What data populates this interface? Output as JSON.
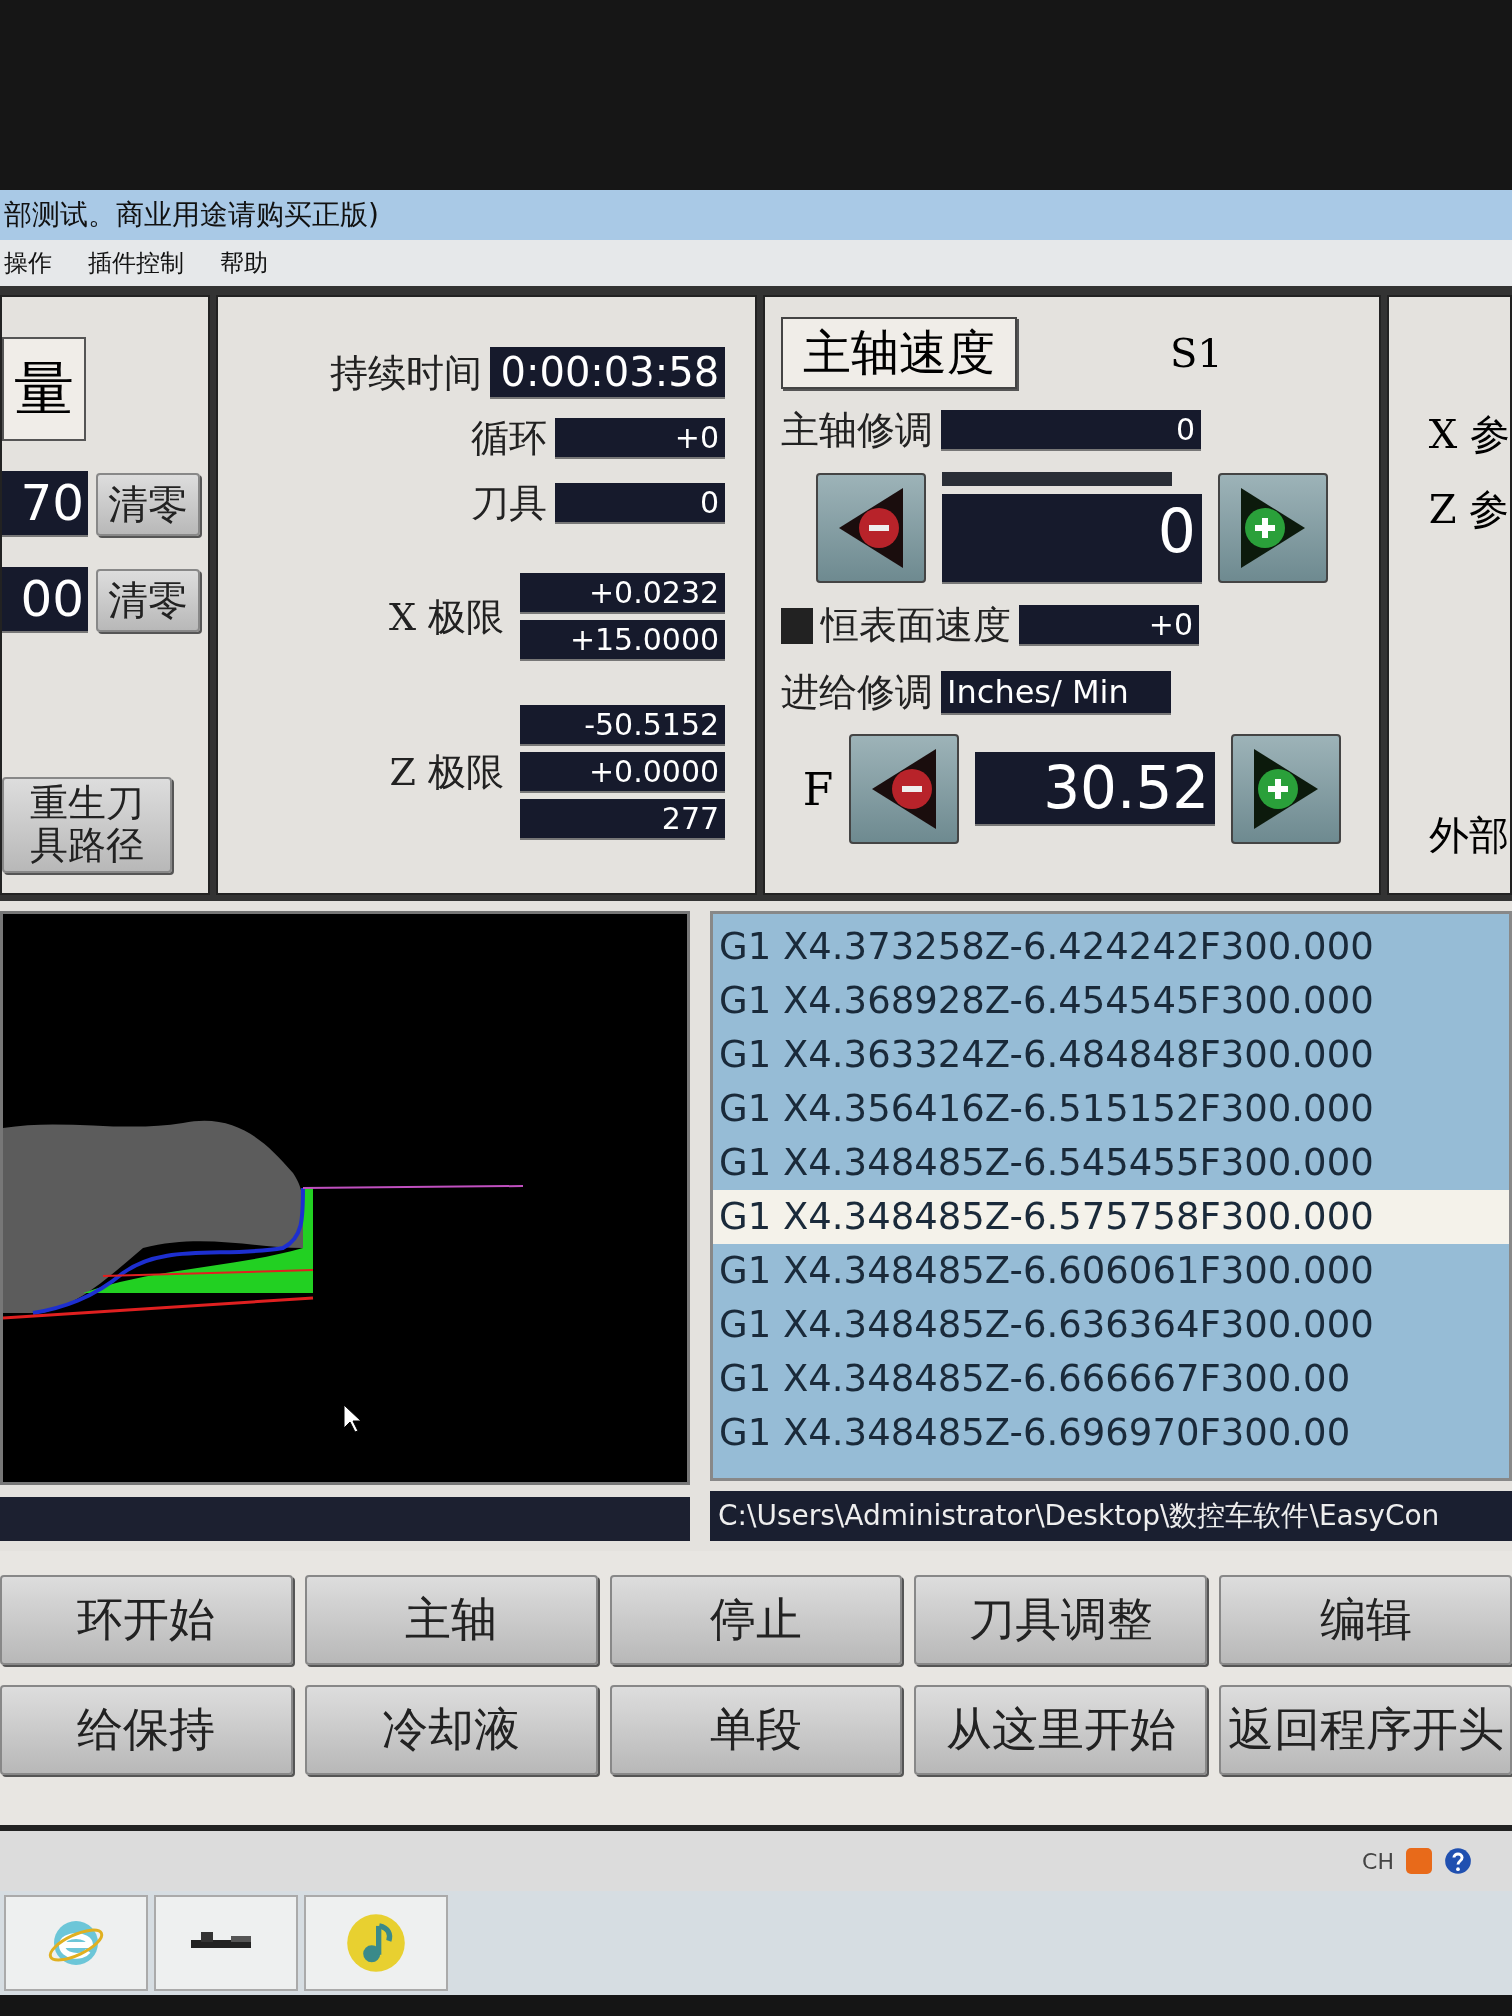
{
  "window": {
    "title": "部测试。商业用途请购买正版)"
  },
  "menu": [
    "操作",
    "插件控制",
    "帮助"
  ],
  "position_panel": {
    "heading": "量",
    "rows": [
      {
        "value": "70",
        "button": "清零"
      },
      {
        "value": "00",
        "button": "清零"
      }
    ],
    "regen_button": "重生刀具路径"
  },
  "status_panel": {
    "fields": [
      {
        "label": "持续时间",
        "value": "0:00:03:58"
      },
      {
        "label": "循环",
        "value": "+0"
      },
      {
        "label": "刀具",
        "value": "0"
      }
    ],
    "limits": [
      {
        "label": "X 极限",
        "values": [
          "+0.0232",
          "+15.0000"
        ]
      },
      {
        "label": "Z 极限",
        "values": [
          "-50.5152",
          "+0.0000",
          "277"
        ]
      }
    ]
  },
  "spindle_panel": {
    "title": "主轴速度",
    "code": "S1",
    "override_label": "主轴修调",
    "override_value": "0",
    "speed_value": "0",
    "css_label": "恒表面速度",
    "css_value": "+0",
    "feed_label": "进给修调",
    "feed_units": "Inches/ Min",
    "feed_prefix": "F",
    "feed_value": "30.52"
  },
  "right_panel": {
    "labels": [
      "X 参",
      "Z 参",
      "外部"
    ]
  },
  "gcode": {
    "lines": [
      {
        "text": "G1 X4.373258Z-6.424242F300.000",
        "selected": false
      },
      {
        "text": "G1 X4.368928Z-6.454545F300.000",
        "selected": false
      },
      {
        "text": "G1 X4.363324Z-6.484848F300.000",
        "selected": false
      },
      {
        "text": "G1 X4.356416Z-6.515152F300.000",
        "selected": false
      },
      {
        "text": "G1 X4.348485Z-6.545455F300.000",
        "selected": false
      },
      {
        "text": "G1 X4.348485Z-6.575758F300.000",
        "selected": true
      },
      {
        "text": "G1 X4.348485Z-6.606061F300.000",
        "selected": false
      },
      {
        "text": "G1 X4.348485Z-6.636364F300.000",
        "selected": false
      },
      {
        "text": "G1 X4.348485Z-6.666667F300.00",
        "selected": false
      },
      {
        "text": "G1 X4.348485Z-6.696970F300.00",
        "selected": false
      }
    ],
    "file_path": "C:\\Users\\Administrator\\Desktop\\数控车软件\\EasyCon"
  },
  "buttons": [
    [
      "环开始",
      "主轴",
      "停止",
      "刀具调整",
      "编辑"
    ],
    [
      "给保持",
      "冷却液",
      "单段",
      "从这里开始",
      "返回程序开头"
    ]
  ],
  "tray": {
    "language": "CH"
  }
}
